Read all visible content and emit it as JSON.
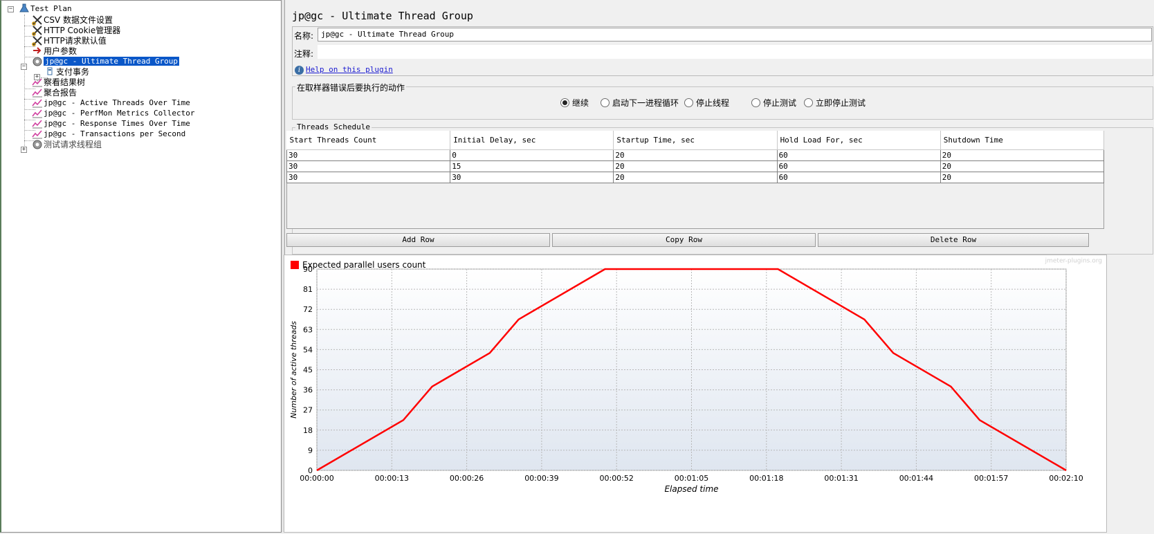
{
  "tree": {
    "items": [
      {
        "label": "Test Plan",
        "icon": "test-plan-icon",
        "cjk": false
      },
      {
        "label": "CSV 数据文件设置",
        "icon": "config-scissors-icon",
        "cjk": true
      },
      {
        "label": "HTTP Cookie管理器",
        "icon": "config-scissors-icon",
        "cjk": true
      },
      {
        "label": "HTTP请求默认值",
        "icon": "config-scissors-icon",
        "cjk": true
      },
      {
        "label": "用户参数",
        "icon": "preprocessor-icon",
        "cjk": true
      },
      {
        "label": "jp@gc - Ultimate Thread Group",
        "icon": "thread-group-gear-icon",
        "cjk": false
      },
      {
        "label": "支付事务",
        "icon": "transaction-controller-icon",
        "cjk": true
      },
      {
        "label": "察看结果树",
        "icon": "listener-graph-icon",
        "cjk": true
      },
      {
        "label": "聚合报告",
        "icon": "listener-graph-icon",
        "cjk": true
      },
      {
        "label": "jp@gc - Active Threads Over Time",
        "icon": "listener-graph-icon",
        "cjk": false
      },
      {
        "label": "jp@gc - PerfMon Metrics Collector",
        "icon": "listener-graph-icon",
        "cjk": false
      },
      {
        "label": "jp@gc - Response Times Over Time",
        "icon": "listener-graph-icon",
        "cjk": false
      },
      {
        "label": "jp@gc - Transactions per Second",
        "icon": "listener-graph-icon",
        "cjk": false
      },
      {
        "label": "测试请求线程组",
        "icon": "thread-group-gear-icon",
        "cjk": true
      }
    ]
  },
  "panel": {
    "title": "jp@gc - Ultimate Thread Group",
    "name_label": "名称:",
    "name_value": "jp@gc - Ultimate Thread Group",
    "comment_label": "注释:",
    "comment_value": "",
    "help_link": "Help on this plugin",
    "error_action_title": "在取样器错误后要执行的动作",
    "error_actions": [
      {
        "label": "继续",
        "selected": true
      },
      {
        "label": "启动下一进程循环",
        "selected": false
      },
      {
        "label": "停止线程",
        "selected": false
      },
      {
        "label": "停止测试",
        "selected": false
      },
      {
        "label": "立即停止测试",
        "selected": false
      }
    ],
    "schedule_title": "Threads Schedule",
    "columns": [
      "Start Threads Count",
      "Initial Delay, sec",
      "Startup Time, sec",
      "Hold Load For, sec",
      "Shutdown Time"
    ],
    "rows": [
      [
        "30",
        "0",
        "20",
        "60",
        "20"
      ],
      [
        "30",
        "15",
        "20",
        "60",
        "20"
      ],
      [
        "30",
        "30",
        "20",
        "60",
        "20"
      ]
    ],
    "buttons": {
      "add": "Add Row",
      "copy": "Copy Row",
      "delete": "Delete Row"
    },
    "watermark": "jmeter-plugins.org"
  },
  "chart_data": {
    "type": "line",
    "legend": "Expected parallel users count",
    "series_color": "#ff0000",
    "xlabel": "Elapsed time",
    "ylabel": "Number of active threads",
    "x_ticks": [
      "00:00:00",
      "00:00:13",
      "00:00:26",
      "00:00:39",
      "00:00:52",
      "00:01:05",
      "00:01:18",
      "00:01:31",
      "00:01:44",
      "00:01:57",
      "00:02:10"
    ],
    "y_ticks": [
      0,
      9,
      18,
      27,
      36,
      45,
      54,
      63,
      72,
      81,
      90
    ],
    "xlim": [
      0,
      130
    ],
    "ylim": [
      0,
      90
    ],
    "points_x_seconds": [
      0,
      15,
      20,
      30,
      35,
      50,
      80,
      85,
      95,
      100,
      110,
      115,
      130
    ],
    "points_y": [
      0,
      22.5,
      37.5,
      52.5,
      67.5,
      90,
      90,
      82.5,
      67.5,
      52.5,
      37.5,
      22.5,
      0
    ]
  }
}
